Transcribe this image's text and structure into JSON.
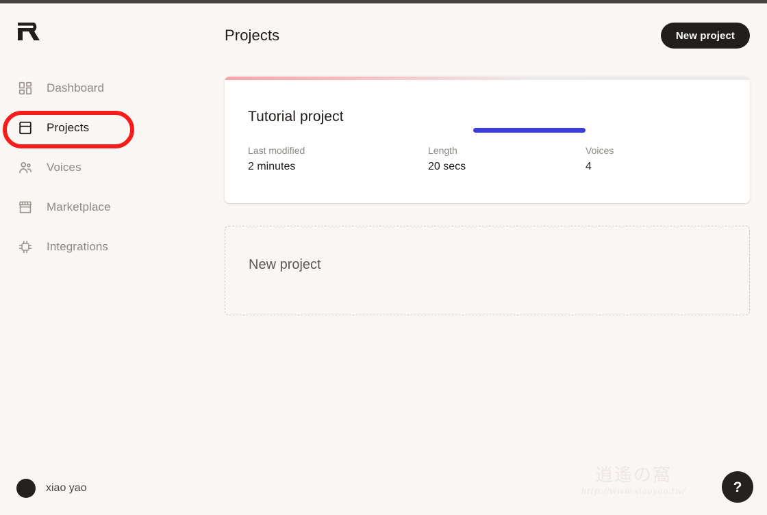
{
  "colors": {
    "page_background": "#faf6f3",
    "accent_dark": "#211e1c",
    "annotation_red": "#f61c1c",
    "annotation_blue": "#3b3edb",
    "card_strip_pink": "#f4a6ac",
    "muted_text": "#8d8884"
  },
  "sidebar": {
    "logo_alt": "resemble-r-logo",
    "items": [
      {
        "label": "Dashboard",
        "icon": "grid-icon",
        "active": false
      },
      {
        "label": "Projects",
        "icon": "projects-icon",
        "active": true
      },
      {
        "label": "Voices",
        "icon": "users-icon",
        "active": false
      },
      {
        "label": "Marketplace",
        "icon": "storefront-icon",
        "active": false
      },
      {
        "label": "Integrations",
        "icon": "chip-icon",
        "active": false
      }
    ],
    "user": {
      "name": "xiao yao",
      "avatar_icon": "avatar-circle"
    }
  },
  "header": {
    "title": "Projects",
    "new_project_label": "New project"
  },
  "project_card": {
    "title": "Tutorial project",
    "stats": [
      {
        "label": "Last modified",
        "value": "2 minutes"
      },
      {
        "label": "Length",
        "value": "20 secs"
      },
      {
        "label": "Voices",
        "value": "4"
      }
    ]
  },
  "new_project_card": {
    "label": "New project"
  },
  "watermark": {
    "characters": "逍遙の窩",
    "url": "http://www.xiaoyao.tw/"
  },
  "help": {
    "label": "?"
  }
}
